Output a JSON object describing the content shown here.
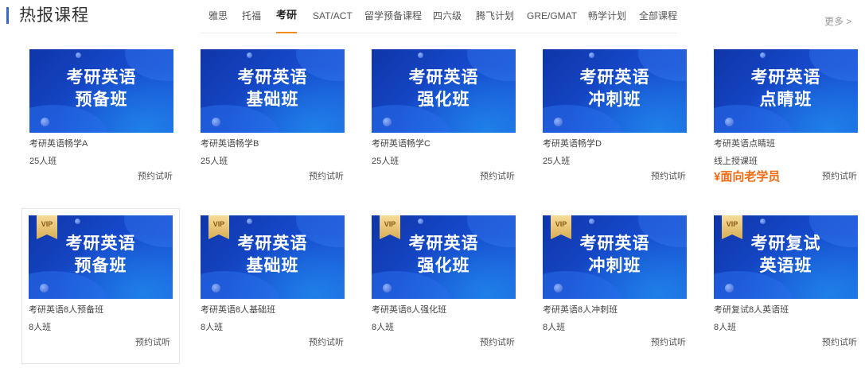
{
  "section": {
    "title": "热报课程",
    "more": "更多 >"
  },
  "tabs": [
    {
      "label": "雅思"
    },
    {
      "label": "托福"
    },
    {
      "label": "考研"
    },
    {
      "label": "SAT/ACT"
    },
    {
      "label": "留学预备课程"
    },
    {
      "label": "四六级"
    },
    {
      "label": "腾飞计划"
    },
    {
      "label": "GRE/GMAT"
    },
    {
      "label": "畅学计划"
    },
    {
      "label": "全部课程"
    }
  ],
  "active_tab": "考研",
  "accent_color": "#f08c1e",
  "row1": [
    {
      "thumb_line1": "考研英语",
      "thumb_line2": "预备班",
      "name": "考研英语畅学A",
      "size": "25人班",
      "trial": "预约试听"
    },
    {
      "thumb_line1": "考研英语",
      "thumb_line2": "基础班",
      "name": "考研英语畅学B",
      "size": "25人班",
      "trial": "预约试听"
    },
    {
      "thumb_line1": "考研英语",
      "thumb_line2": "强化班",
      "name": "考研英语畅学C",
      "size": "25人班",
      "trial": "预约试听"
    },
    {
      "thumb_line1": "考研英语",
      "thumb_line2": "冲刺班",
      "name": "考研英语畅学D",
      "size": "25人班",
      "trial": "预约试听"
    },
    {
      "thumb_line1": "考研英语",
      "thumb_line2": "点睛班",
      "name": "考研英语点睛班",
      "size": "线上授课班",
      "price": "¥面向老学员",
      "trial": "预约试听"
    }
  ],
  "row2": [
    {
      "vip": "VIP",
      "thumb_line1": "考研英语",
      "thumb_line2": "预备班",
      "name": "考研英语8人预备班",
      "size": "8人班",
      "trial": "预约试听"
    },
    {
      "vip": "VIP",
      "thumb_line1": "考研英语",
      "thumb_line2": "基础班",
      "name": "考研英语8人基础班",
      "size": "8人班",
      "trial": "预约试听"
    },
    {
      "vip": "VIP",
      "thumb_line1": "考研英语",
      "thumb_line2": "强化班",
      "name": "考研英语8人强化班",
      "size": "8人班",
      "trial": "预约试听"
    },
    {
      "vip": "VIP",
      "thumb_line1": "考研英语",
      "thumb_line2": "冲刺班",
      "name": "考研英语8人冲刺班",
      "size": "8人班",
      "trial": "预约试听"
    },
    {
      "vip": "VIP",
      "thumb_line1": "考研复试",
      "thumb_line2": "英语班",
      "name": "考研复试8人英语班",
      "size": "8人班",
      "trial": "预约试听"
    }
  ]
}
